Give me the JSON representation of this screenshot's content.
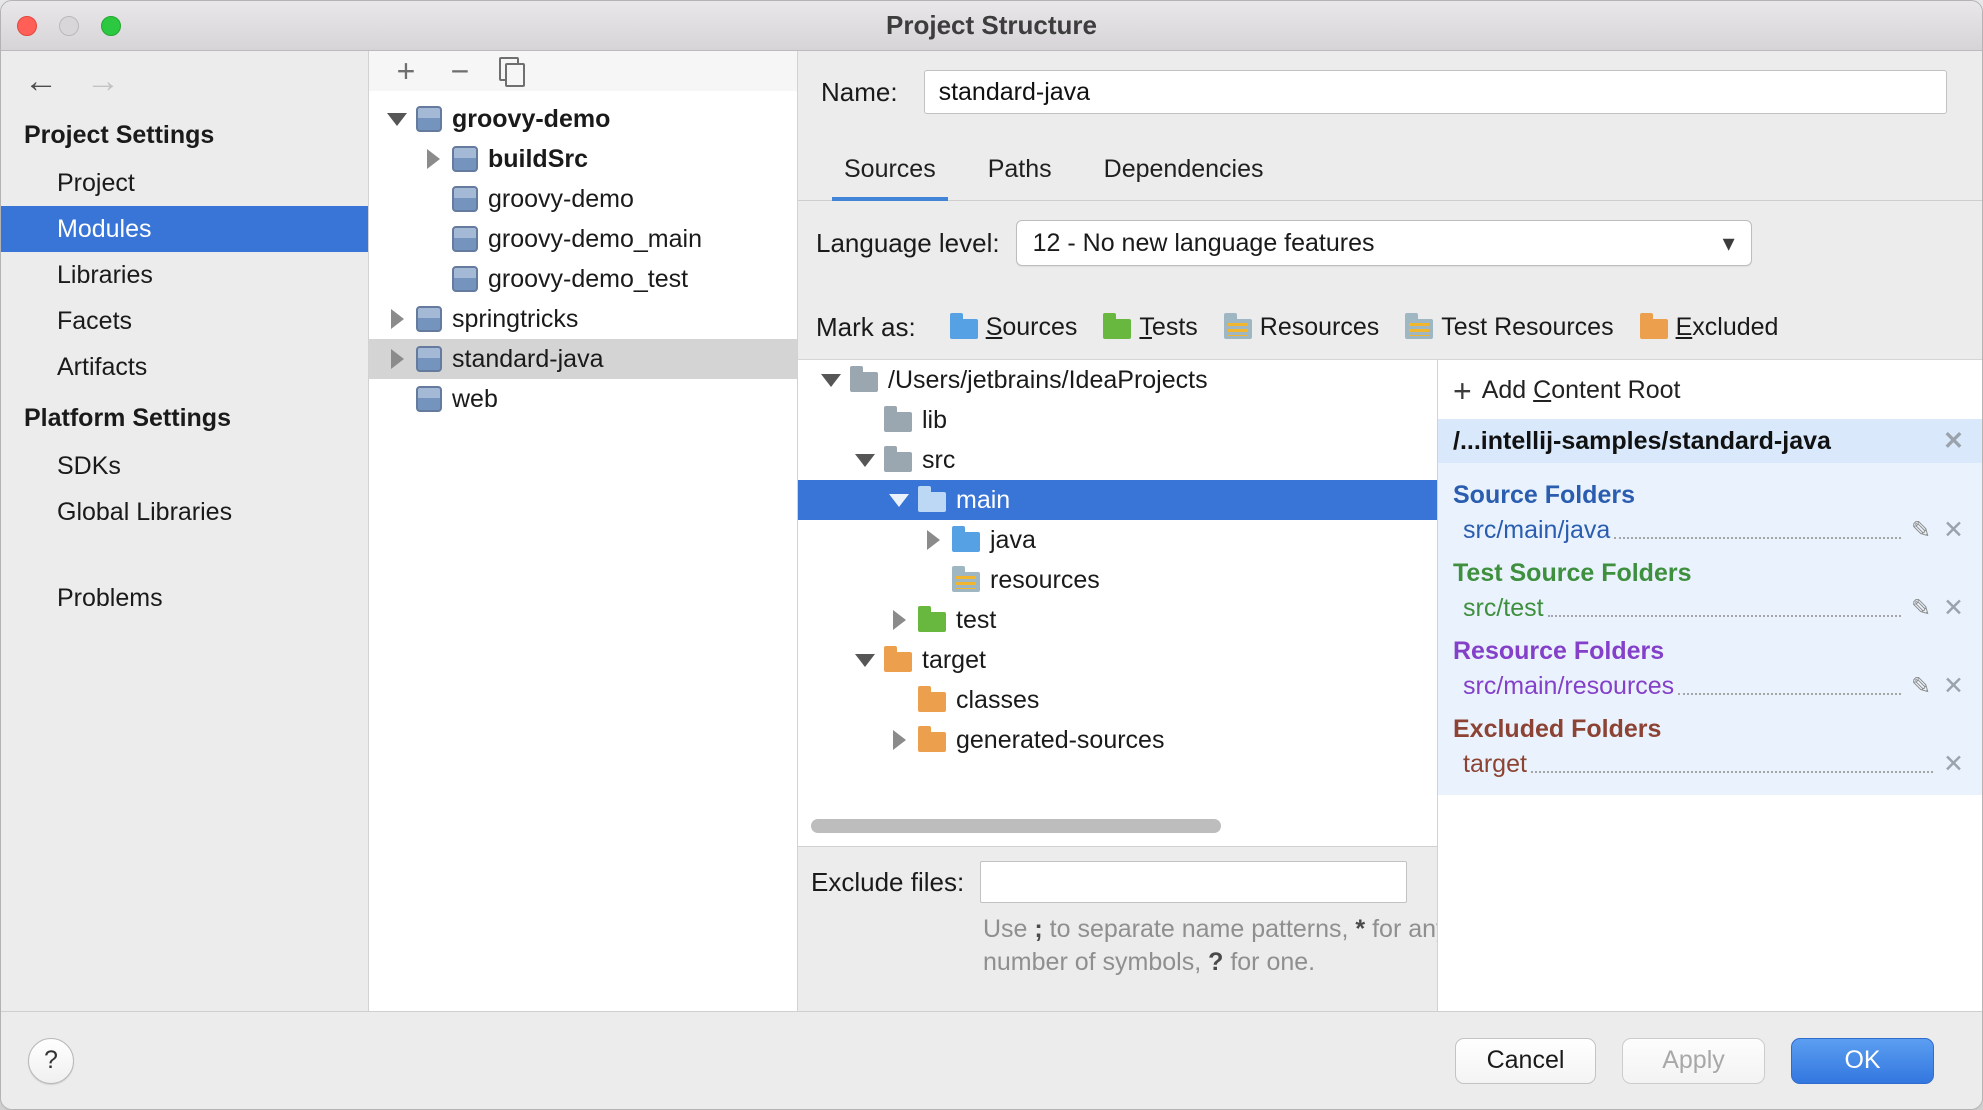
{
  "window": {
    "title": "Project Structure"
  },
  "icons": {
    "back": "←",
    "forward": "→",
    "add": "+",
    "remove": "−",
    "dropdown_caret": "▾",
    "close": "✕",
    "edit_pencil": "✎",
    "help": "?",
    "plus": "+"
  },
  "colors": {
    "selection_blue": "#3875d7",
    "tab_underline": "#4285d8",
    "source_blue": "#2a5db0",
    "test_green": "#3e8f3e",
    "resource_purple": "#8440c8",
    "excluded_brown": "#8c4334",
    "ok_button_blue": "#3377e0",
    "folder_blue": "#56a0e4",
    "folder_green": "#68b73e",
    "folder_orange": "#eca04e",
    "folder_gray": "#9aa7b0"
  },
  "sidebar": {
    "sections": [
      {
        "header": "Project Settings",
        "items": [
          {
            "label": "Project"
          },
          {
            "label": "Modules"
          },
          {
            "label": "Libraries"
          },
          {
            "label": "Facets"
          },
          {
            "label": "Artifacts"
          }
        ]
      },
      {
        "header": "Platform Settings",
        "items": [
          {
            "label": "SDKs"
          },
          {
            "label": "Global Libraries"
          }
        ]
      }
    ],
    "problems_label": "Problems",
    "selected_item": "Modules"
  },
  "modules_panel": {
    "tree": [
      {
        "label": "groovy-demo"
      },
      {
        "label": "buildSrc"
      },
      {
        "label": "groovy-demo"
      },
      {
        "label": "groovy-demo_main"
      },
      {
        "label": "groovy-demo_test"
      },
      {
        "label": "springtricks"
      },
      {
        "label": "standard-java"
      },
      {
        "label": "web"
      }
    ],
    "selected_item": "standard-java"
  },
  "module_editor": {
    "name_label": "Name:",
    "name_value": "standard-java",
    "tabs": [
      {
        "label": "Sources"
      },
      {
        "label": "Paths"
      },
      {
        "label": "Dependencies"
      }
    ],
    "selected_tab": "Sources",
    "language_level_label": "Language level:",
    "language_level_value": "12 - No new language features",
    "mark_as_label": "Mark as:",
    "mark_as": [
      {
        "mnemonic": "S",
        "rest": "ources"
      },
      {
        "mnemonic": "T",
        "rest": "ests"
      },
      {
        "mnemonic": "",
        "rest": "Resources"
      },
      {
        "mnemonic": "",
        "rest": "Test Resources"
      },
      {
        "mnemonic": "E",
        "rest": "xcluded"
      }
    ],
    "file_tree": [
      {
        "label": "/Users/jetbrains/IdeaProjects"
      },
      {
        "label": "lib"
      },
      {
        "label": "src"
      },
      {
        "label": "main"
      },
      {
        "label": "java"
      },
      {
        "label": "resources"
      },
      {
        "label": "test"
      },
      {
        "label": "target"
      },
      {
        "label": "classes"
      },
      {
        "label": "generated-sources"
      }
    ],
    "selected_tree_item": "main",
    "exclude_files_label": "Exclude files:",
    "exclude_files_value": "",
    "hint_parts": [
      "Use ",
      ";",
      " to separate name patterns, ",
      "*",
      " for any number of symbols, ",
      "?",
      " for one."
    ]
  },
  "content_root_panel": {
    "add_content_root": {
      "pre": "Add ",
      "mnemonic": "C",
      "rest": "ontent Root"
    },
    "root_path": "/...intellij-samples/standard-java",
    "groups": [
      {
        "header": "Source Folders",
        "path": "src/main/java"
      },
      {
        "header": "Test Source Folders",
        "path": "src/test"
      },
      {
        "header": "Resource Folders",
        "path": "src/main/resources"
      },
      {
        "header": "Excluded Folders",
        "path": "target"
      }
    ]
  },
  "footer": {
    "help": "?",
    "cancel": "Cancel",
    "apply": "Apply",
    "ok": "OK"
  }
}
